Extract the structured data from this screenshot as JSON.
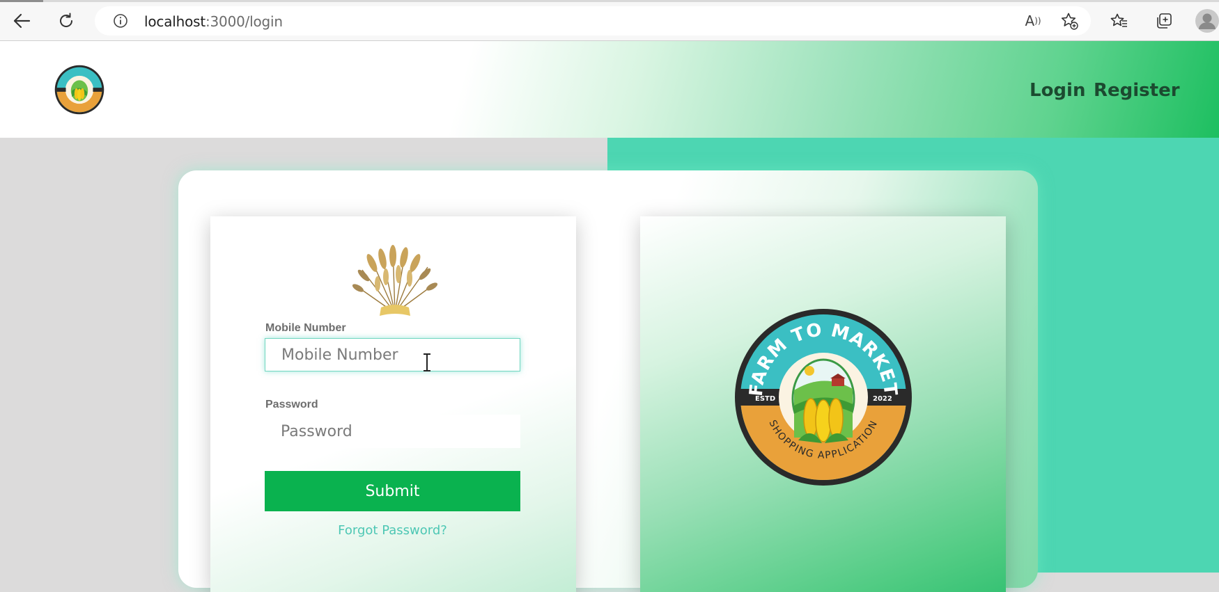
{
  "browser": {
    "url_host": "localhost",
    "url_path": ":3000/login",
    "icons": [
      "back-arrow-icon",
      "refresh-icon",
      "site-info-icon",
      "read-aloud-icon",
      "add-favorite-icon",
      "favorites-icon",
      "collections-icon",
      "profile-icon"
    ]
  },
  "header": {
    "nav": {
      "login_label": "Login",
      "register_label": "Register"
    }
  },
  "login_form": {
    "mobile": {
      "label": "Mobile Number",
      "placeholder": "Mobile Number",
      "value": ""
    },
    "password": {
      "label": "Password",
      "placeholder": "Password",
      "value": ""
    },
    "submit_label": "Submit",
    "forgot_label": "Forgot Password?"
  },
  "brand_logo": {
    "title": "FARM TO MARKET",
    "subtitle": "SHOPPING APPLICATION",
    "estd_label": "ESTD",
    "year": "2022"
  },
  "colors": {
    "accent_green": "#0ab24f",
    "teal": "#4dd6b2",
    "link": "#4dc7b4",
    "nav_text": "#1c4a30",
    "logo_orange": "#e9a13a",
    "logo_teal": "#3bbfc3"
  }
}
